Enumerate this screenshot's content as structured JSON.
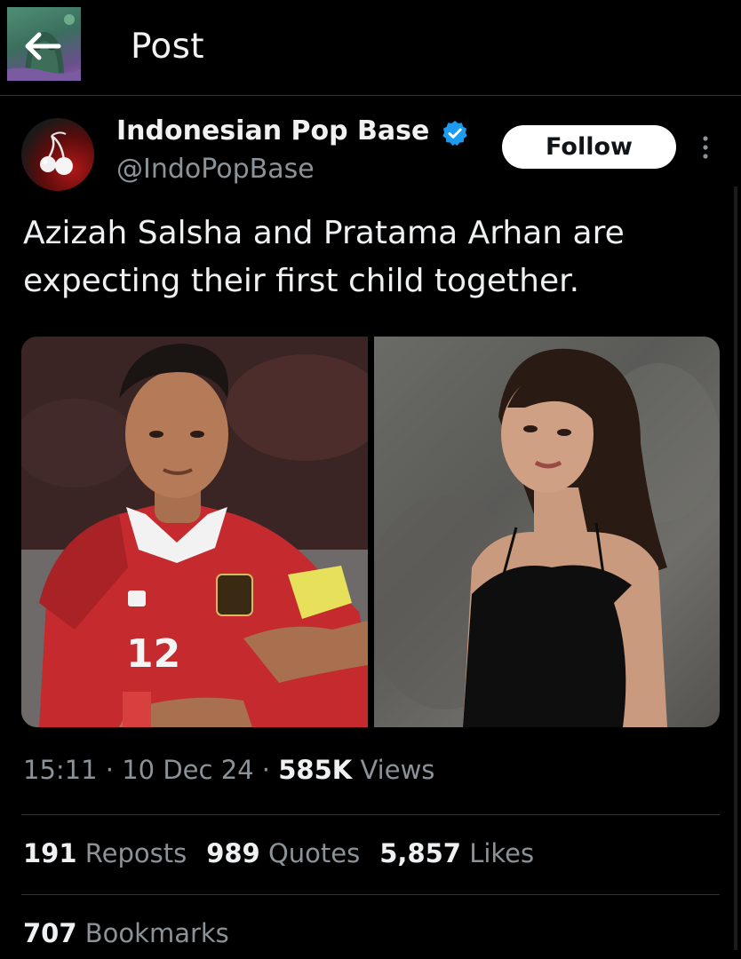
{
  "header": {
    "title": "Post",
    "back_icon": "arrow-left-icon"
  },
  "author": {
    "name": "Indonesian Pop Base",
    "handle": "@IndoPopBase",
    "verified_color": "#1d9bf0",
    "follow_label": "Follow"
  },
  "post": {
    "text": "Azizah Salsha and Pratama Arhan are expecting their first child together."
  },
  "media": {
    "left_jersey_number": "12"
  },
  "meta": {
    "time": "15:11",
    "sep1": " · ",
    "date": "10 Dec 24",
    "sep2": " · ",
    "views_count": "585K",
    "views_label": " Views"
  },
  "stats": {
    "reposts_count": "191",
    "reposts_label": " Reposts",
    "quotes_count": "989",
    "quotes_label": " Quotes",
    "likes_count": "5,857",
    "likes_label": " Likes",
    "bookmarks_count": "707",
    "bookmarks_label": " Bookmarks"
  },
  "colors": {
    "background": "#000000",
    "muted_text": "#8b9298",
    "divider": "#2f3336"
  }
}
